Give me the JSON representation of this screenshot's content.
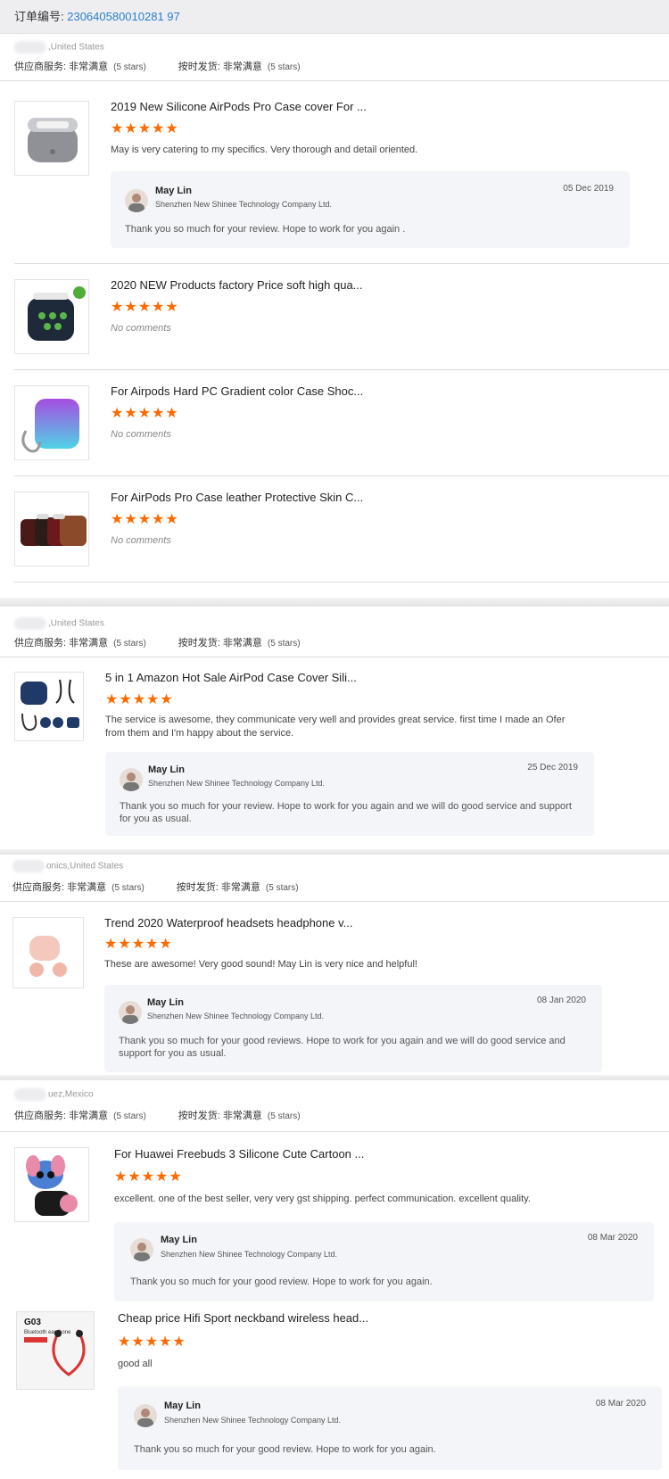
{
  "order": {
    "label": "订单编号: ",
    "number": "230640580010281 97"
  },
  "sections": [
    {
      "location": ",United States",
      "supplier_service_label": "供应商服务: 非常满意",
      "supplier_service_stars": "(5 stars)",
      "ontime_label": "按时发货: 非常满意",
      "ontime_stars": "(5 stars)"
    },
    {
      "location": ",United States",
      "supplier_service_label": "供应商服务: 非常满意",
      "supplier_service_stars": "(5 stars)",
      "ontime_label": "按时发货: 非常满意",
      "ontime_stars": "(5 stars)"
    },
    {
      "location": "onics,United States",
      "supplier_service_label": "供应商服务: 非常满意",
      "supplier_service_stars": "(5 stars)",
      "ontime_label": "按时发货: 非常满意",
      "ontime_stars": "(5 stars)"
    },
    {
      "location": "uez,Mexico",
      "supplier_service_label": "供应商服务: 非常满意",
      "supplier_service_stars": "(5 stars)",
      "ontime_label": "按时发货: 非常满意",
      "ontime_stars": "(5 stars)"
    }
  ],
  "items": [
    {
      "title": "2019 New Silicone AirPods Pro Case cover For ...",
      "stars": "★★★★★",
      "comment": "May is very catering to my specifics. Very thorough and detail oriented.",
      "reply": {
        "name": "May Lin",
        "company": "Shenzhen New Shinee Technology Company Ltd.",
        "date": "05 Dec 2019",
        "text": "Thank you so much for your review. Hope to work for you again ."
      }
    },
    {
      "title": "2020 NEW Products factory Price soft high qua...",
      "stars": "★★★★★",
      "comment": "No comments"
    },
    {
      "title": "For Airpods Hard PC Gradient color Case Shoc...",
      "stars": "★★★★★",
      "comment": "No comments"
    },
    {
      "title": "For AirPods Pro Case leather Protective Skin C...",
      "stars": "★★★★★",
      "comment": "No comments"
    },
    {
      "title": "5 in 1 Amazon Hot Sale AirPod Case Cover Sili...",
      "stars": "★★★★★",
      "comment": "The service is awesome, they communicate very well and provides great service. first time I made an Ofer from them and I'm happy about the service.",
      "reply": {
        "name": "May Lin",
        "company": "Shenzhen New Shinee Technology Company Ltd.",
        "date": "25 Dec 2019",
        "text": "Thank you so much for your review. Hope to work for you again and we will do good service and support for you as usual."
      }
    },
    {
      "title": "Trend 2020 Waterproof headsets headphone v...",
      "stars": "★★★★★",
      "comment": "These are awesome! Very good sound! May Lin is very nice and helpful!",
      "reply": {
        "name": "May Lin",
        "company": "Shenzhen New Shinee Technology Company Ltd.",
        "date": "08 Jan 2020",
        "text": "Thank you so much for your good reviews. Hope to work for you again and we will do good service and support for you as usual."
      }
    },
    {
      "title": "For Huawei Freebuds 3 Silicone Cute Cartoon ...",
      "stars": "★★★★★",
      "comment": "excellent. one of the best seller, very very gst shipping. perfect communication. excellent quality.",
      "reply": {
        "name": "May Lin",
        "company": "Shenzhen New Shinee Technology Company Ltd.",
        "date": "08 Mar 2020",
        "text": "Thank you so much for your good review. Hope to work for you again."
      }
    },
    {
      "title": "Cheap price Hifi Sport neckband wireless head...",
      "stars": "★★★★★",
      "comment": "good all",
      "reply": {
        "name": "May Lin",
        "company": "Shenzhen New Shinee Technology Company Ltd.",
        "date": "08 Mar 2020",
        "text": "Thank you so much for your good review. Hope to work for you again."
      }
    }
  ],
  "thumb_labels": {
    "g03": "G03",
    "g03_sub": "Bluetooth earphone"
  }
}
